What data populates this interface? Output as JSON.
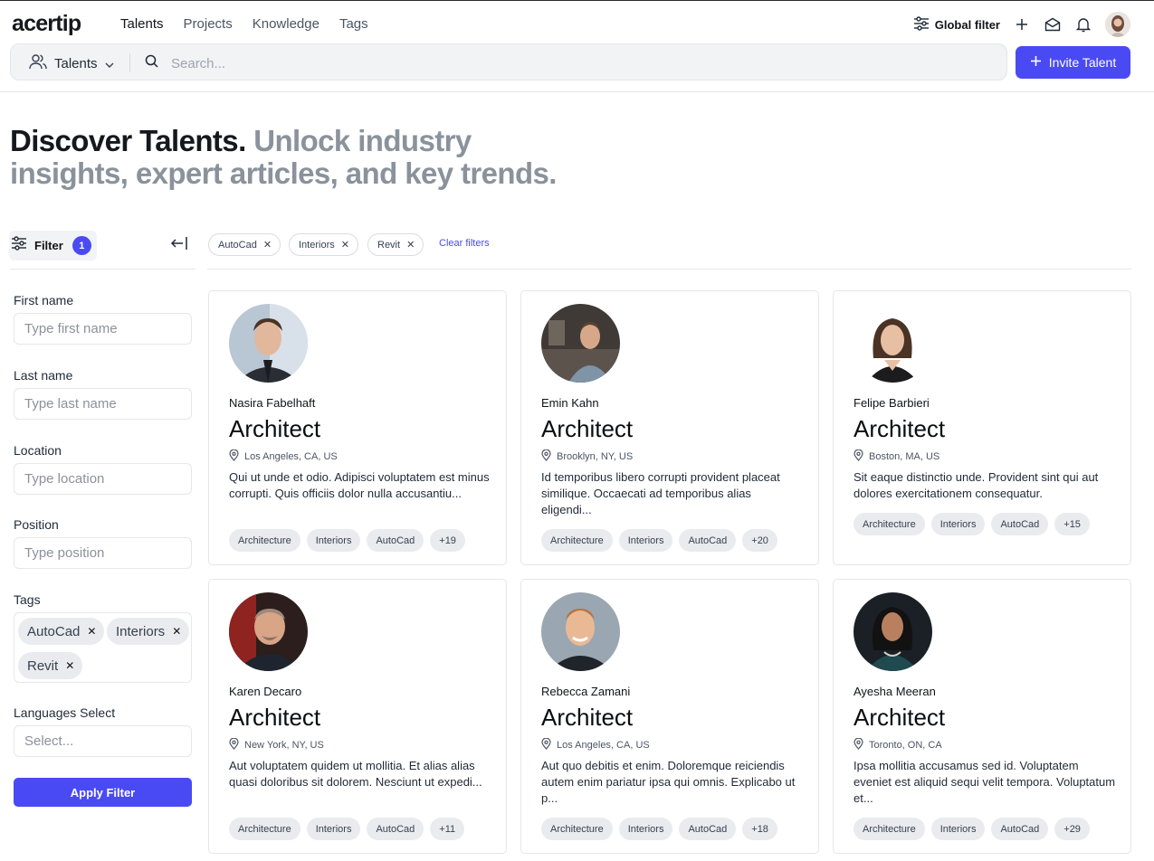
{
  "app": {
    "logo": "acertip"
  },
  "nav": {
    "items": [
      "Talents",
      "Projects",
      "Knowledge",
      "Tags"
    ],
    "active": "Talents"
  },
  "header": {
    "global_filter_label": "Global filter"
  },
  "search": {
    "scope_label": "Talents",
    "placeholder": "Search..."
  },
  "invite": {
    "label": "Invite Talent"
  },
  "hero": {
    "title_dark": "Discover Talents.",
    "title_muted": "Unlock industry insights, expert articles, and key trends."
  },
  "sidebar": {
    "filter_label": "Filter",
    "filter_count": "1",
    "first_name": {
      "label": "First name",
      "placeholder": "Type first name"
    },
    "last_name": {
      "label": "Last name",
      "placeholder": "Type last name"
    },
    "location": {
      "label": "Location",
      "placeholder": "Type location"
    },
    "position": {
      "label": "Position",
      "placeholder": "Type position"
    },
    "tags": {
      "label": "Tags",
      "values": [
        "AutoCad",
        "Interiors",
        "Revit"
      ]
    },
    "languages": {
      "label": "Languages Select",
      "placeholder": "Select..."
    },
    "apply_label": "Apply Filter"
  },
  "active_filters": {
    "items": [
      "AutoCad",
      "Interiors",
      "Revit"
    ],
    "clear_label": "Clear filters"
  },
  "colors": {
    "accent": "#4a4af4",
    "muted_text": "#8a929b",
    "chip_bg": "#e9ebee"
  },
  "talents": [
    {
      "name": "Nasira Fabelhaft",
      "role": "Architect",
      "location": "Los Angeles, CA, US",
      "description": "Qui ut unde et odio. Adipisci voluptatem est minus corrupti. Quis officiis dolor nulla accusantiu...",
      "tags": [
        "Architecture",
        "Interiors",
        "AutoCad",
        "+19"
      ]
    },
    {
      "name": "Emin Kahn",
      "role": "Architect",
      "location": "Brooklyn, NY, US",
      "description": "Id temporibus libero corrupti provident placeat similique. Occaecati ad temporibus alias eligendi...",
      "tags": [
        "Architecture",
        "Interiors",
        "AutoCad",
        "+20"
      ]
    },
    {
      "name": "Felipe Barbieri",
      "role": "Architect",
      "location": "Boston, MA, US",
      "description": "Sit eaque distinctio unde. Provident sint qui aut dolores exercitationem consequatur.",
      "tags": [
        "Architecture",
        "Interiors",
        "AutoCad",
        "+15"
      ]
    },
    {
      "name": "Karen Decaro",
      "role": "Architect",
      "location": "New York, NY, US",
      "description": "Aut voluptatem quidem ut mollitia. Et alias alias quasi doloribus sit dolorem. Nesciunt ut expedi...",
      "tags": [
        "Architecture",
        "Interiors",
        "AutoCad",
        "+11"
      ]
    },
    {
      "name": "Rebecca Zamani",
      "role": "Architect",
      "location": "Los Angeles, CA, US",
      "description": "Aut quo debitis et enim. Doloremque reiciendis autem enim pariatur ipsa qui omnis. Explicabo ut p...",
      "tags": [
        "Architecture",
        "Interiors",
        "AutoCad",
        "+18"
      ]
    },
    {
      "name": "Ayesha Meeran",
      "role": "Architect",
      "location": "Toronto, ON, CA",
      "description": "Ipsa mollitia accusamus sed id. Voluptatem eveniet est aliquid sequi velit tempora. Voluptatum et...",
      "tags": [
        "Architecture",
        "Interiors",
        "AutoCad",
        "+29"
      ]
    }
  ]
}
